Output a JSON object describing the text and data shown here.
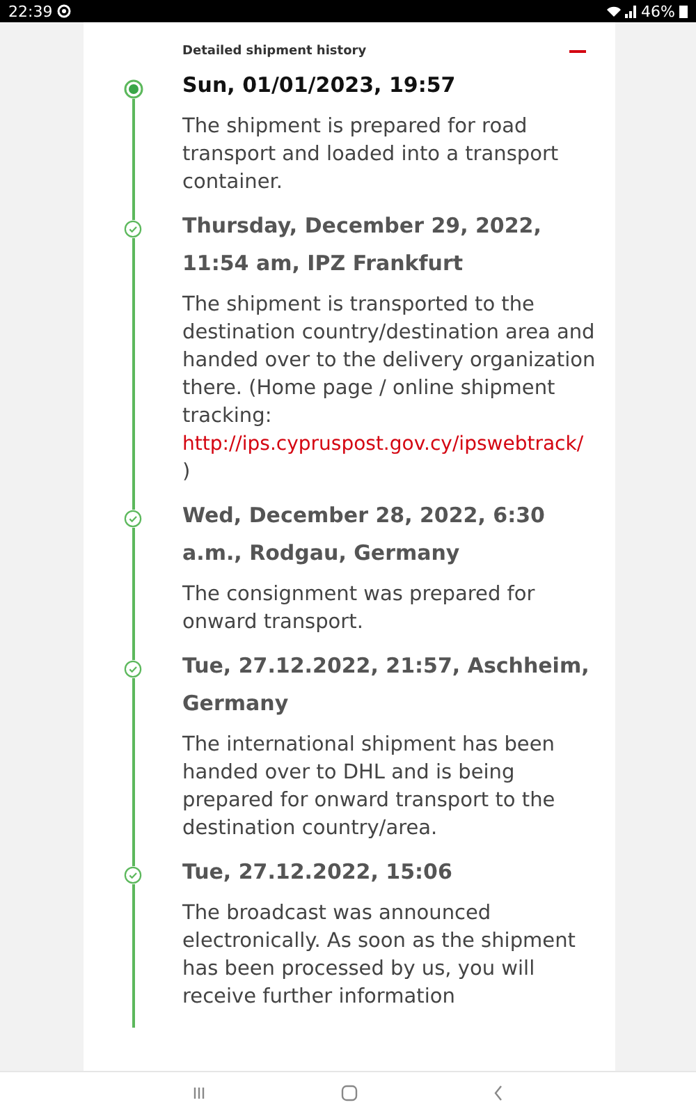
{
  "status_bar": {
    "time": "22:39",
    "battery": "46%"
  },
  "section": {
    "title": "Detailed shipment history",
    "expanded": true
  },
  "events": [
    {
      "current": true,
      "heading": "Sun, 01/01/2023, 19:57",
      "text": "The shipment is prepared for road transport and loaded into a transport container."
    },
    {
      "current": false,
      "heading": "Thursday, December 29, 2022, 11:54 am, IPZ Frankfurt",
      "text": "The shipment is transported to the destination country/destination area and handed over to the delivery organization there. (Home page / online shipment tracking:",
      "link": "http://ips.cypruspost.gov.cy/ipswebtrack/",
      "after": ")"
    },
    {
      "current": false,
      "heading": "Wed, December 28, 2022, 6:30 a.m., Rodgau, Germany",
      "text": "The consignment was prepared for onward transport."
    },
    {
      "current": false,
      "heading": "Tue, 27.12.2022, 21:57, Aschheim, Germany",
      "text": "The international shipment has been handed over to DHL and is being prepared for onward transport to the destination country/area."
    },
    {
      "current": false,
      "heading": "Tue, 27.12.2022, 15:06",
      "text": "The broadcast was announced electronically. As soon as the shipment has been processed by us, you will receive further information"
    }
  ]
}
